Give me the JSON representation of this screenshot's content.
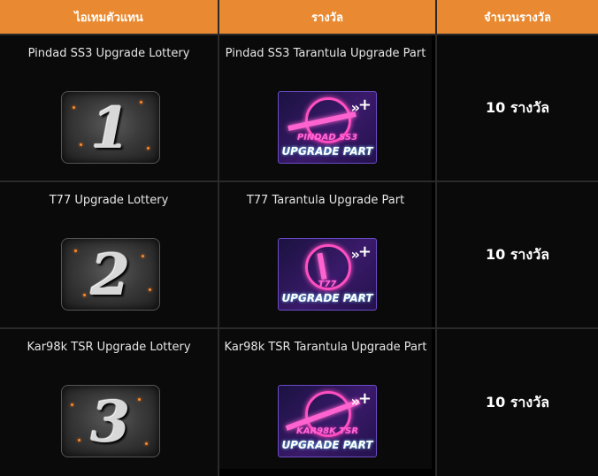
{
  "headers": [
    "ไอเทมตัวแทน",
    "รางวัล",
    "จำนวนรางวัล"
  ],
  "rows": [
    {
      "item": "Pindad SS3 Upgrade Lottery",
      "lottery_number": "1",
      "reward": "Pindad SS3 Tarantula Upgrade Part",
      "reward_badge_name": "PINDAD SS3",
      "reward_badge_sub": "UPGRADE PART",
      "quantity": "10 รางวัล"
    },
    {
      "item": "T77 Upgrade Lottery",
      "lottery_number": "2",
      "reward": "T77 Tarantula Upgrade Part",
      "reward_badge_name": "T77",
      "reward_badge_sub": "UPGRADE PART",
      "quantity": "10 รางวัล"
    },
    {
      "item": "Kar98k TSR Upgrade Lottery",
      "lottery_number": "3",
      "reward": "Kar98k TSR Tarantula Upgrade Part",
      "reward_badge_name": "KAR98K TSR",
      "reward_badge_sub": "UPGRADE PART",
      "quantity": "10 รางวัล"
    }
  ],
  "colors": {
    "header_bg": "#e98a32",
    "header_text": "#ffffff",
    "body_bg": "#0a0a0a",
    "border": "#2a2a2a",
    "neon_pink": "#ff4fc0",
    "neon_blue": "#6fd6ff"
  },
  "icons": {
    "lottery": "lottery-ticket-icon",
    "reward": "upgrade-part-icon"
  }
}
